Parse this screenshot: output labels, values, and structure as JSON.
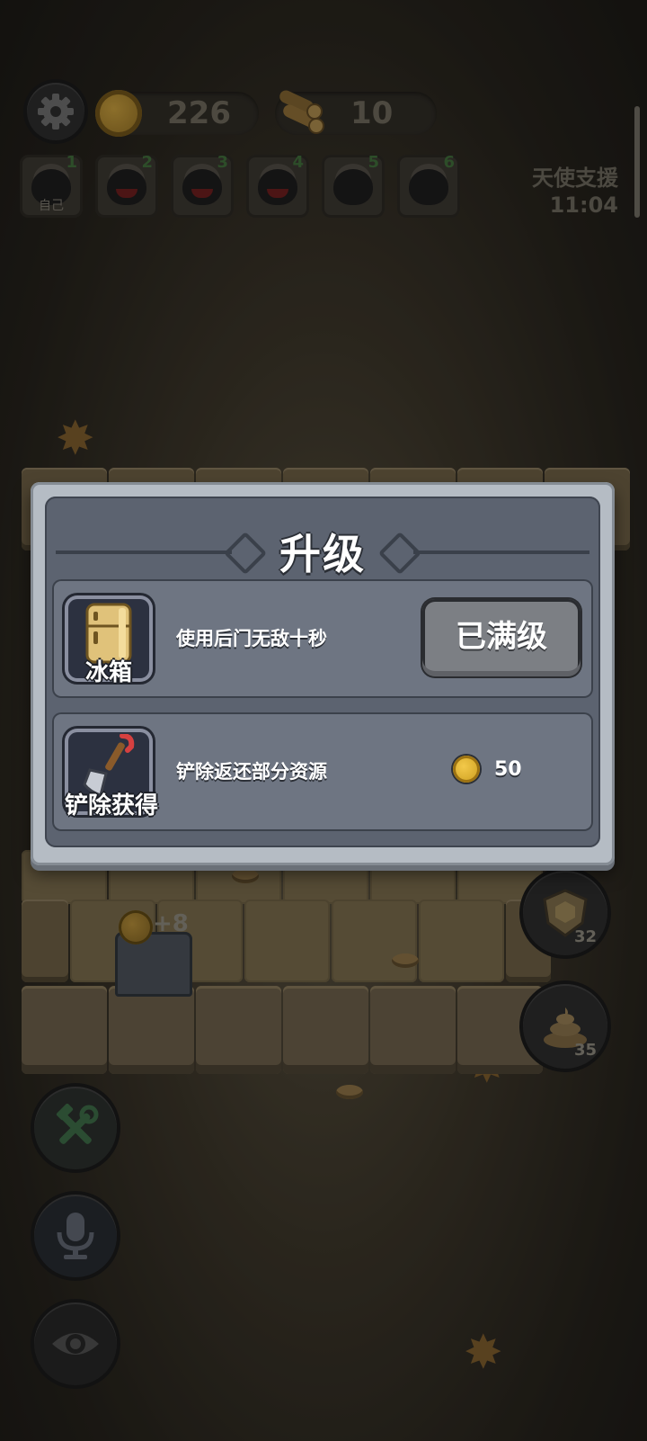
{
  "hud": {
    "coins": "226",
    "wood": "10",
    "side_label": "天使支援",
    "timer": "11:04"
  },
  "players": [
    {
      "num": "1",
      "label": "自己"
    },
    {
      "num": "2"
    },
    {
      "num": "3"
    },
    {
      "num": "4"
    },
    {
      "num": "5"
    },
    {
      "num": "6"
    }
  ],
  "side_buttons": [
    {
      "icon": "shield-icon",
      "count": "32"
    },
    {
      "icon": "poop-icon",
      "count": "35"
    }
  ],
  "door_bonus": "+8",
  "dialog": {
    "title": "升级",
    "items": [
      {
        "icon": "fridge-icon",
        "name": "冰箱",
        "description": "使用后门无敌十秒",
        "button_label": "已满级"
      },
      {
        "icon": "shovel-icon",
        "name": "铲除获得",
        "description": "铲除返还部分资源",
        "cost": "50"
      }
    ]
  },
  "colors": {
    "dialog_frame": "#b5bcc4",
    "dialog_inner": "#5c6370",
    "card": "#6e7582",
    "coin": "#f3c94a"
  }
}
